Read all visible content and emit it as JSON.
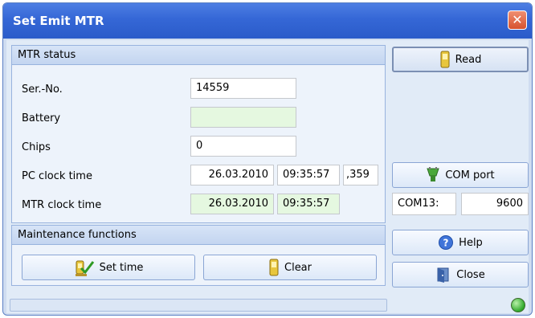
{
  "window": {
    "title": "Set Emit MTR",
    "close_glyph": "✕"
  },
  "mtr_status": {
    "header": "MTR status",
    "ser_no_label": "Ser.-No.",
    "ser_no_value": "14559",
    "battery_label": "Battery",
    "battery_value": "",
    "chips_label": "Chips",
    "chips_value": "0",
    "pc_clock_label": "PC clock time",
    "pc_clock_date": "26.03.2010",
    "pc_clock_time": "09:35:57",
    "pc_clock_ms": ",359",
    "mtr_clock_label": "MTR clock time",
    "mtr_clock_date": "26.03.2010",
    "mtr_clock_time": "09:35:57"
  },
  "maintenance": {
    "header": "Maintenance functions",
    "set_time_label": "Set time",
    "clear_label": "Clear"
  },
  "side": {
    "read_label": "Read",
    "com_port_label": "COM port",
    "com_port_value": "COM13:",
    "baud_value": "9600",
    "help_label": "Help",
    "close_label": "Close"
  },
  "icons": {
    "read": "device-icon",
    "com_port": "plug-icon",
    "help": "help-icon",
    "close": "exit-door-icon",
    "set_time": "device-check-icon",
    "clear": "device-icon",
    "status": "status-led-icon"
  },
  "colors": {
    "titlebar": "#3567d6",
    "status_led": "#2fa82a",
    "green_field": "#e5f8e0"
  }
}
